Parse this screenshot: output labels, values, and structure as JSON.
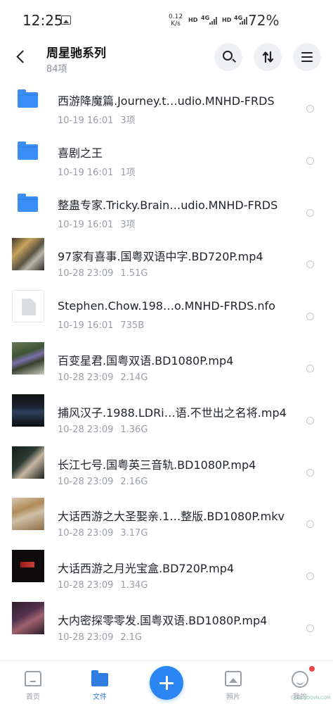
{
  "status_bar": {
    "time": "12:25",
    "net_speed_value": "0.12",
    "net_speed_unit": "K/s",
    "hd1": "HD",
    "net1": "4G",
    "hd2": "HD",
    "net2": "4G",
    "battery": "72%"
  },
  "header": {
    "title": "周星驰系列",
    "subtitle": "84项"
  },
  "files": [
    {
      "name": "西游降魔篇.Journey.t…udio.MNHD-FRDS",
      "date": "10-19 16:01",
      "detail": "3项",
      "kind": "folder"
    },
    {
      "name": "喜剧之王",
      "date": "10-19 16:01",
      "detail": "1项",
      "kind": "folder"
    },
    {
      "name": "整蛊专家.Tricky.Brain…udio.MNHD-FRDS",
      "date": "10-19 16:01",
      "detail": "3项",
      "kind": "folder"
    },
    {
      "name": "97家有喜事.国粤双语中字.BD720P.mp4",
      "date": "10-28 23:09",
      "detail": "1.51G",
      "kind": "video"
    },
    {
      "name": "Stephen.Chow.198…o.MNHD-FRDS.nfo",
      "date": "10-19 16:01",
      "detail": "735B",
      "kind": "file"
    },
    {
      "name": "百变星君.国粤双语.BD1080P.mp4",
      "date": "10-28 23:09",
      "detail": "2.14G",
      "kind": "video"
    },
    {
      "name": "捕风汉子.1988.LDRi…语.不世出之名将.mp4",
      "date": "10-28 23:09",
      "detail": "1.36G",
      "kind": "video"
    },
    {
      "name": "长江七号.国粤英三音轨.BD1080P.mp4",
      "date": "10-28 23:09",
      "detail": "2.16G",
      "kind": "video"
    },
    {
      "name": "大话西游之大圣娶亲.1…整版.BD1080P.mkv",
      "date": "10-28 23:09",
      "detail": "3.17G",
      "kind": "video"
    },
    {
      "name": "大话西游之月光宝盒.BD720P.mp4",
      "date": "10-28 23:09",
      "detail": "1.34G",
      "kind": "video"
    },
    {
      "name": "大内密探零零发.国粤双语.BD1080P.mp4",
      "date": "10-28 23:09",
      "detail": "2.1G",
      "kind": "video"
    }
  ],
  "bottom_nav": {
    "home": "首页",
    "files": "文件",
    "photos": "照片",
    "me": "我的"
  },
  "watermark": "CLUB.GOOVN.COM",
  "colors": {
    "accent": "#2b86f3",
    "folder": "#3b8ef5",
    "badge": "#f04646"
  }
}
